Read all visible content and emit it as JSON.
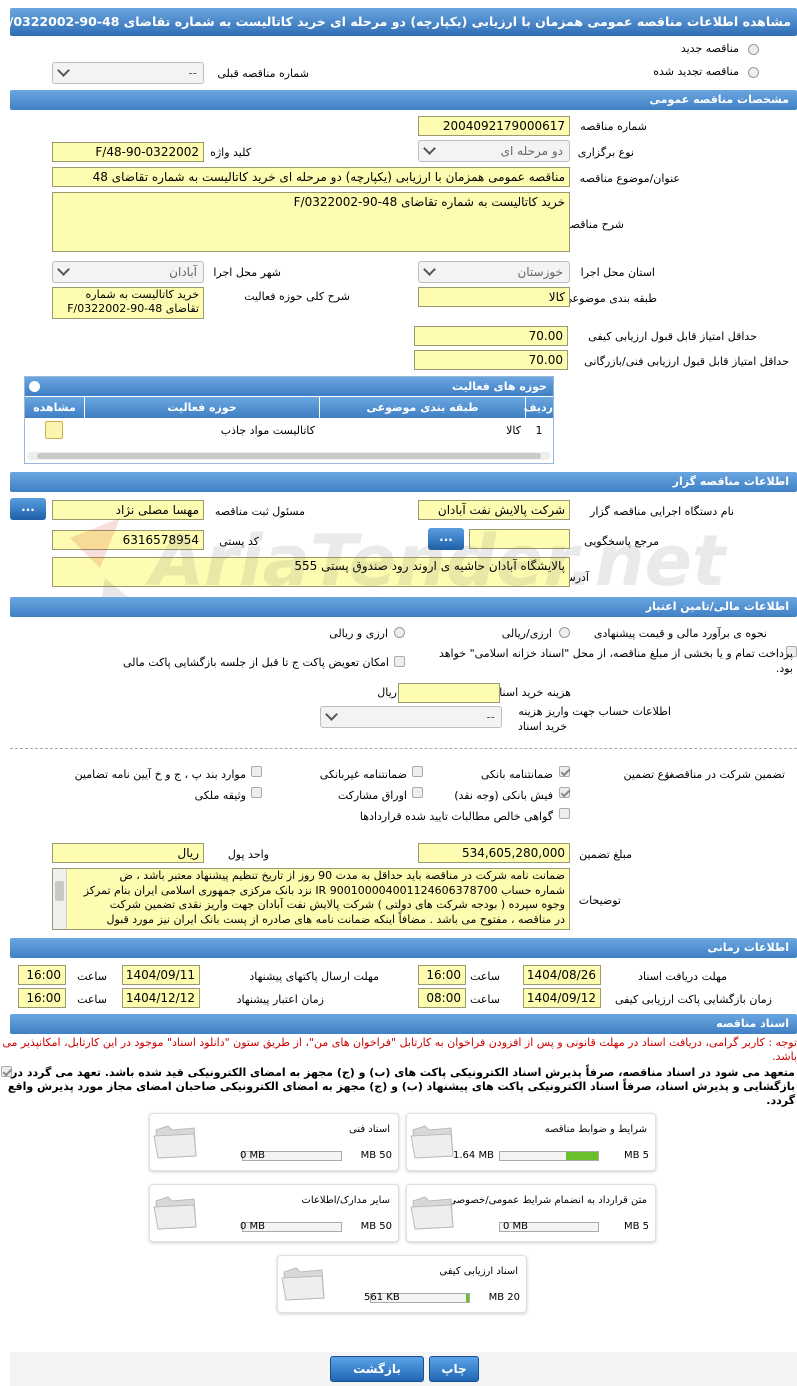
{
  "title": "مشاهده اطلاعات مناقصه عمومی همزمان با ارزیابی (یکپارچه) دو مرحله ای خرید کاتالیست به شماره تقاضای F/0322002-90-48",
  "top": {
    "new_tender": "مناقصه جدید",
    "renewed_tender": "مناقصه تجدید شده",
    "prev_number_label": "شماره مناقصه قبلی",
    "prev_number_value": "--"
  },
  "general": {
    "header": "مشخصات مناقصه عمومی",
    "number_label": "شماره مناقصه",
    "number": "2004092179000617",
    "type_label": "نوع برگزاری",
    "type": "دو مرحله ای",
    "keyword_label": "کلید واژه",
    "keyword": "F/48-90-0322002",
    "subject_label": "عنوان/موضوع مناقصه",
    "subject": "مناقصه عمومی همزمان با ارزیابی (یکپارچه) دو مرحله ای خرید کاتالیست به شماره تقاضای 48",
    "desc_label": "شرح مناقصه",
    "desc": "خرید کاتالیست به شماره تقاضای 48-90-F/0322002",
    "province_label": "استان محل اجرا",
    "province": "خوزستان",
    "city_label": "شهر محل اجرا",
    "city": "آبادان",
    "category_label": "طبقه بندی موضوعی",
    "category": "کالا",
    "scope_label": "شرح کلی حوزه فعالیت",
    "scope_line1": "خرید کاتالیست به شماره",
    "scope_line2": "تقاضای 48-90-F/0322002",
    "min_quality_label": "حداقل امتیاز قابل قبول ارزیابی کیفی",
    "min_quality": "70.00",
    "min_tech_label": "حداقل امتیاز قابل قبول ارزیابی فنی/بازرگانی",
    "min_tech": "70.00"
  },
  "activity": {
    "header": "حوزه های فعالیت",
    "col_row": "ردیف",
    "col_category": "طبقه بندی موضوعی",
    "col_field": "حوزه فعالیت",
    "col_view": "مشاهده",
    "rows": [
      {
        "row": "1",
        "category": "کالا",
        "field": "کاتالیست مواد جاذب"
      }
    ]
  },
  "organizer": {
    "header": "اطلاعات مناقصه گزار",
    "org_label": "نام دستگاه اجرایی مناقصه گزار",
    "org": "شرکت پالایش نفت آبادان",
    "officer_label": "مسئول ثبت مناقصه",
    "officer": "مهسا مصلی نژاد",
    "ref_label": "مرجع پاسخگویی",
    "ref": "",
    "postal_label": "کد پستی",
    "postal": "6316578954",
    "address_label": "آدرس",
    "address": "پالایشگاه آبادان حاشیه ی اروند رود صندوق پستی 555",
    "dots": "..."
  },
  "finance": {
    "header": "اطلاعات مالی/تامین اعتبار",
    "estimate_label": "نحوه ی برآورد مالی و قیمت پیشنهادی",
    "opt_fx": "ارزی/ریالی",
    "opt_fx_rial": "ارزی و ریالی",
    "treasury_text": "پرداخت تمام و یا بخشی از مبلغ مناقصه، از محل \"اسناد خزانه اسلامی\" خواهد بود.",
    "swap_text": "امکان تعویض پاکت ج تا قبل از جلسه بازگشایی پاکت مالی",
    "doc_fee_label": "هزینه خرید اسناد",
    "doc_fee_unit": "ریال",
    "doc_fee": "",
    "account_label1": "اطلاعات حساب جهت واریز هزینه",
    "account_label2": "خرید اسناد",
    "account": "--"
  },
  "guarantee": {
    "intro_label": "تضمین شرکت در مناقصه:",
    "type_label": "نوع تضمین",
    "items": [
      "ضمانتنامه بانکی",
      "ضمانتنامه غیربانکی",
      "موارد بند پ ، ج و خ آیین نامه تضامین",
      "فیش بانکی (وجه نقد)",
      "اوراق مشارکت",
      "وثیقه ملکی",
      "گواهی خالص مطالبات تایید شده قراردادها"
    ],
    "amount_label": "مبلغ تضمین",
    "amount": "534,605,280,000",
    "currency_label": "واحد پول",
    "currency": "ریال",
    "notes_label": "توضیحات",
    "notes": [
      "ضمانت نامه شرکت در مناقصه باید حداقل به مدت 90 روز از تاریخ تنظیم پیشنهاد معتبر باشد ، ض",
      "شماره حساب IR 900100004001124606378700 نزد بانک مرکزی جمهوری اسلامی ایران بنام تمرکز",
      "وجوه سپرده ( بودجه شرکت های دولتی ) شرکت پالایش نفت آبادان جهت واریز نقدی تضمین شرکت",
      "در مناقصه ، مفتوح می باشد . مضافاً اینکه ضمانت نامه های صادره از پست بانک ایران نیز مورد قبول"
    ]
  },
  "timing": {
    "header": "اطلاعات زمانی",
    "get_docs_label": "مهلت دریافت اسناد",
    "get_docs_date": "1404/08/26",
    "get_docs_time": "16:00",
    "send_label": "مهلت ارسال پاکتهای پیشنهاد",
    "send_date": "1404/09/11",
    "send_time": "16:00",
    "open_label": "زمان بازگشایی پاکت ارزیابی کیفی",
    "open_date": "1404/09/12",
    "open_time": "08:00",
    "valid_label": "زمان اعتبار پیشنهاد",
    "valid_date": "1404/12/12",
    "valid_time": "16:00",
    "time_label": "ساعت"
  },
  "documents": {
    "header": "اسناد مناقصه",
    "note": "توجه : کاربر گرامی، دریافت اسناد در مهلت قانونی و پس از افزودن فراخوان به کارتابل \"فراخوان های من\"، از طریق ستون \"دانلود اسناد\" موجود در این کارتابل، امکانپذیر می باشد.",
    "commitment": "متعهد می شود در اسناد مناقصه، صرفاً پذیرش اسناد الکترونیکی پاکت های (ب) و (ج) مجهز به امضای الکترونیکی قید شده باشد. تعهد می گردد در بازگشایی و پذیرش اسناد، صرفاً اسناد الکترونیکی پاکت های پیشنهاد (ب) و (ج) مجهز به امضای الکترونیکی صاحبان امضای مجاز مورد پذیرش واقع گردد.",
    "items": [
      {
        "name": "شرایط و ضوابط مناقصه",
        "max": "5 MB",
        "cur": "1.64 MB",
        "progress": 0.33
      },
      {
        "name": "اسناد فنی",
        "max": "50 MB",
        "cur": "0 MB",
        "progress": 0
      },
      {
        "name": "متن قرارداد به انضمام شرایط عمومی/خصوصی",
        "max": "5 MB",
        "cur": "0 MB",
        "progress": 0
      },
      {
        "name": "سایر مدارک/اطلاعات",
        "max": "50 MB",
        "cur": "0 MB",
        "progress": 0
      },
      {
        "name": "اسناد ارزیابی کیفی",
        "max": "20 MB",
        "cur": "561 KB",
        "progress": 0.03
      }
    ]
  },
  "buttons": {
    "print": "چاپ",
    "back": "بازگشت"
  },
  "watermark": "AriaTender.net"
}
